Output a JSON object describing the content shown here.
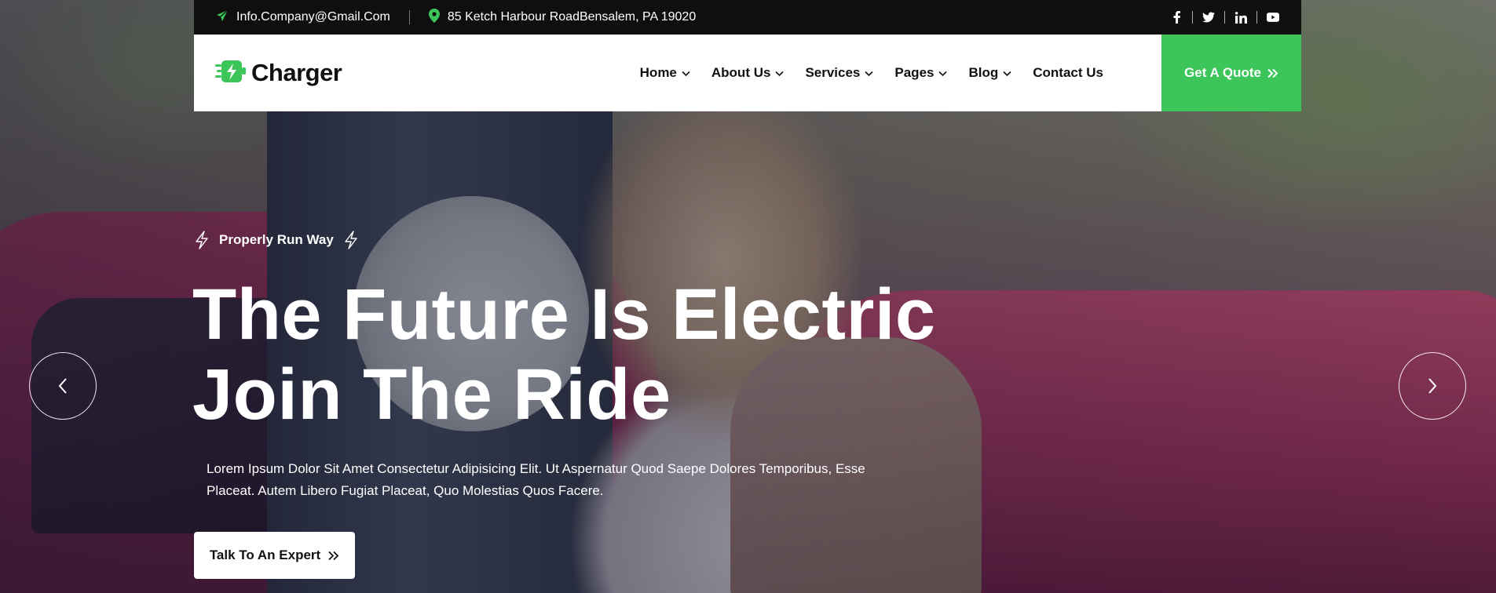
{
  "topbar": {
    "email": "Info.Company@Gmail.Com",
    "address": "85 Ketch Harbour RoadBensalem, PA 19020",
    "social": [
      "facebook-icon",
      "twitter-icon",
      "linkedin-icon",
      "youtube-icon"
    ]
  },
  "brand": {
    "name": "Charger",
    "accent": "#3cc65a"
  },
  "nav": {
    "items": [
      {
        "label": "Home"
      },
      {
        "label": "About Us"
      },
      {
        "label": "Services"
      },
      {
        "label": "Pages"
      },
      {
        "label": "Blog"
      },
      {
        "label": "Contact Us"
      }
    ],
    "cta": "Get A Quote"
  },
  "hero": {
    "tagline": "Properly Run Way",
    "headline_line1": "The Future Is Electric",
    "headline_line2": "Join The Ride",
    "description": "Lorem Ipsum Dolor Sit Amet Consectetur Adipisicing Elit. Ut Aspernatur Quod Saepe Dolores Temporibus, Esse Placeat. Autem Libero Fugiat Placeat, Quo Molestias Quos Facere.",
    "button": "Talk To An Expert"
  }
}
